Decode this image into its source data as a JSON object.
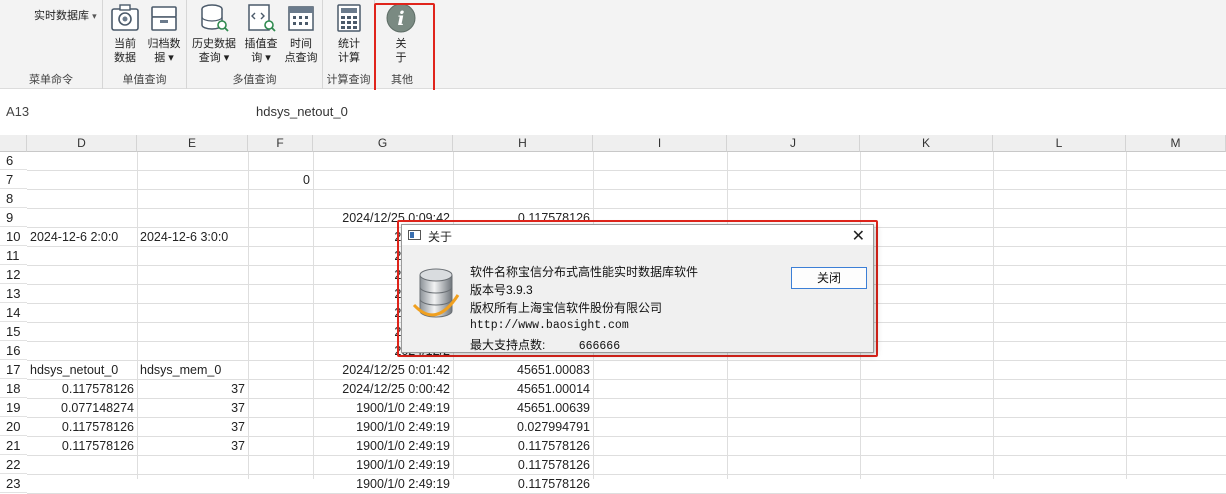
{
  "ribbon": {
    "menu_button": "实时数据库",
    "menu_arrow": "▾",
    "groups": [
      {
        "label": "菜单命令"
      },
      {
        "label": "单值查询"
      },
      {
        "label": "多值查询"
      },
      {
        "label": "计算查询"
      },
      {
        "label": "其他"
      }
    ],
    "buttons": {
      "current": {
        "line1": "当前",
        "line2": "数据"
      },
      "archive": {
        "line1": "归档数",
        "line2": "据 ▾"
      },
      "history": {
        "line1": "历史数据",
        "line2": "查询 ▾"
      },
      "interp": {
        "line1": "插值查",
        "line2": "询 ▾"
      },
      "timepoint": {
        "line1": "时间",
        "line2": "点查询"
      },
      "stats": {
        "line1": "统计",
        "line2": "计算"
      },
      "about": {
        "line1": "关",
        "line2": "于",
        "icon_glyph": "i"
      }
    }
  },
  "formula_bar": {
    "name_box": "A13",
    "content": "hdsys_netout_0"
  },
  "columns": [
    "D",
    "E",
    "F",
    "G",
    "H",
    "I",
    "J",
    "K",
    "L",
    "M"
  ],
  "rows": [
    "6",
    "7",
    "8",
    "9",
    "10",
    "11",
    "12",
    "13",
    "14",
    "15",
    "16",
    "17",
    "18",
    "19",
    "20",
    "21",
    "22",
    "23"
  ],
  "cells": {
    "F7": "0",
    "G9": "2024/12/25 0:09:42",
    "H9": "0.117578126",
    "D10": "2024-12-6 2:0:0",
    "E10": "2024-12-6 3:0:0",
    "G10": "2024/12/2",
    "G11": "2024/12/2",
    "G12": "2024/12/2",
    "G13": "2024/12/2",
    "G14": "2024/12/2",
    "G15": "2024/12/2",
    "G16": "2024/12/2",
    "D17": "hdsys_netout_0",
    "E17": "hdsys_mem_0",
    "G17": "2024/12/25 0:01:42",
    "H17": "45651.00083",
    "D18": "0.117578126",
    "E18": "37",
    "G18": "2024/12/25 0:00:42",
    "H18": "45651.00014",
    "D19": "0.077148274",
    "E19": "37",
    "G19": "1900/1/0 2:49:19",
    "H19": "45651.00639",
    "D20": "0.117578126",
    "E20": "37",
    "G20": "1900/1/0 2:49:19",
    "H20": "0.027994791",
    "D21": "0.117578126",
    "E21": "37",
    "G21": "1900/1/0 2:49:19",
    "H21": "0.117578126",
    "G22": "1900/1/0 2:49:19",
    "H22": "0.117578126",
    "G23": "1900/1/0 2:49:19",
    "H23": "0.117578126"
  },
  "dialog": {
    "title": "关于",
    "close_glyph": "✕",
    "software_name": "软件名称宝信分布式高性能实时数据库软件",
    "version": "版本号3.9.3",
    "copyright": "版权所有上海宝信软件股份有限公司",
    "url": "http://www.baosight.com",
    "max_points_label": "最大支持点数:",
    "max_points_value": "666666",
    "close_button": "关闭"
  },
  "colors": {
    "highlight_red": "#e0241b",
    "button_blue_border": "#3c7fd6"
  }
}
